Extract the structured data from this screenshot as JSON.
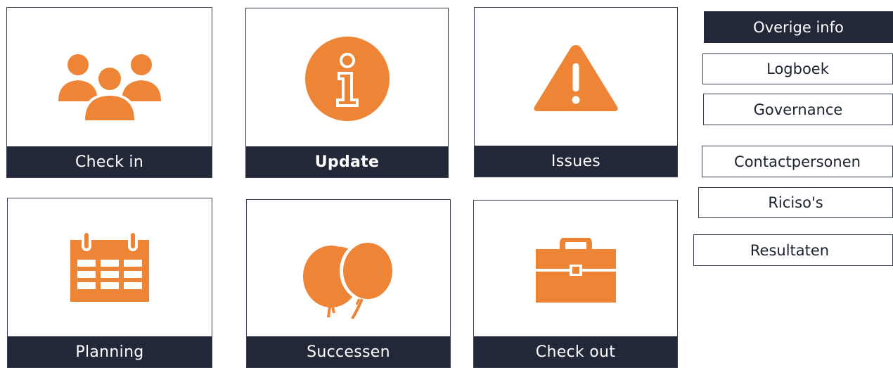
{
  "colors": {
    "accent": "#EE8435",
    "dark": "#222838",
    "border": "#3A3F4F",
    "background": "#FFFFFF"
  },
  "tiles": [
    {
      "label": "Check in",
      "icon": "people-group-icon"
    },
    {
      "label": "Update",
      "icon": "info-icon"
    },
    {
      "label": "Issues",
      "icon": "warning-icon"
    },
    {
      "label": "Planning",
      "icon": "calendar-icon"
    },
    {
      "label": "Successen",
      "icon": "balloons-icon"
    },
    {
      "label": "Check out",
      "icon": "briefcase-icon"
    }
  ],
  "side_menu": {
    "items": [
      {
        "label": "Overige info",
        "active": true
      },
      {
        "label": "Logboek"
      },
      {
        "label": "Governance"
      },
      {
        "label": "Contactpersonen"
      },
      {
        "label": "Riciso's"
      },
      {
        "label": "Resultaten"
      }
    ]
  }
}
